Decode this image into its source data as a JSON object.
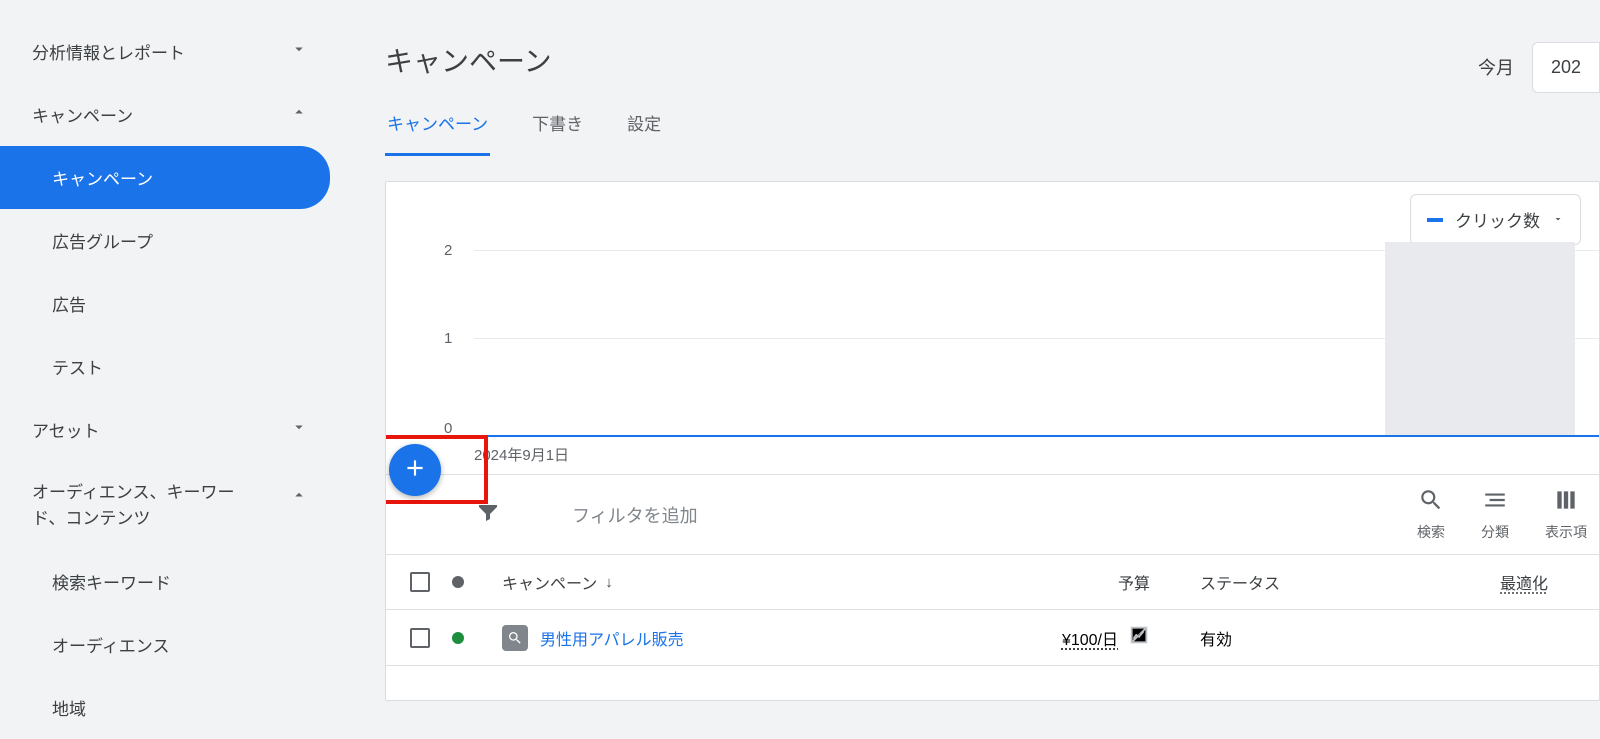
{
  "sidebar": {
    "insights": {
      "label": "分析情報とレポート",
      "expanded": false
    },
    "campaigns": {
      "label": "キャンペーン",
      "expanded": true,
      "items": [
        {
          "label": "キャンペーン",
          "active": true
        },
        {
          "label": "広告グループ"
        },
        {
          "label": "広告"
        },
        {
          "label": "テスト"
        }
      ]
    },
    "assets": {
      "label": "アセット",
      "expanded": false
    },
    "audiences": {
      "label": "オーディエンス、キーワード、コンテンツ",
      "expanded": true,
      "items": [
        {
          "label": "検索キーワード"
        },
        {
          "label": "オーディエンス"
        },
        {
          "label": "地域"
        }
      ]
    }
  },
  "main": {
    "title": "キャンペーン",
    "date": {
      "preset": "今月",
      "button": "202"
    },
    "tabs": [
      {
        "label": "キャンペーン",
        "active": true
      },
      {
        "label": "下書き"
      },
      {
        "label": "設定"
      }
    ],
    "chart": {
      "metric_label": "クリック数",
      "y_ticks": [
        "2",
        "1",
        "0"
      ],
      "x_label": "2024年9月1日"
    },
    "toolbar": {
      "filter_placeholder": "フィルタを追加",
      "search": "検索",
      "segment": "分類",
      "columns": "表示項"
    },
    "table": {
      "headers": {
        "name": "キャンペーン",
        "budget": "予算",
        "status": "ステータス",
        "opt": "最適化"
      },
      "rows": [
        {
          "status_color": "green",
          "name": "男性用アパレル販売",
          "budget": "¥100/日",
          "status": "有効"
        }
      ]
    }
  },
  "chart_data": {
    "type": "line",
    "title": "",
    "xlabel": "",
    "ylabel": "",
    "ylim": [
      0,
      2
    ],
    "series": [
      {
        "name": "クリック数",
        "values": [
          0
        ]
      }
    ],
    "categories": [
      "2024年9月1日"
    ]
  }
}
